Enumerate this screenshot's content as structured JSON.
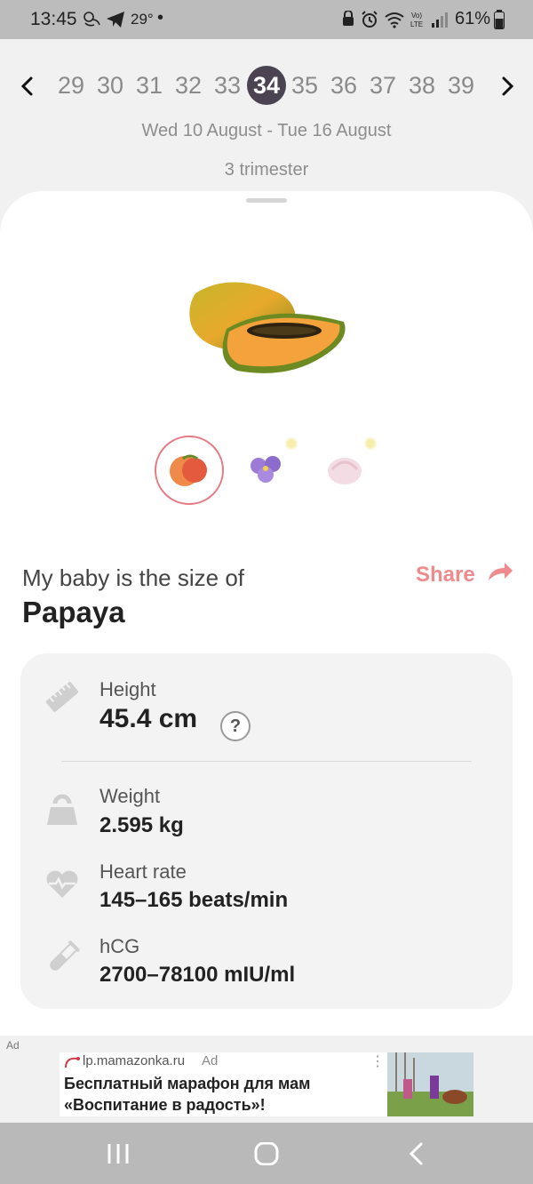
{
  "status_bar": {
    "time": "13:45",
    "temperature": "29°",
    "notification_dot": "•",
    "battery": "61%",
    "icons": [
      "baby-icon",
      "telegram-icon",
      "lock-icon",
      "alarm-icon",
      "wifi-icon",
      "volte-icon",
      "signal-icon",
      "battery-icon"
    ]
  },
  "week_selector": {
    "prev_icon": "chevron-left-icon",
    "next_icon": "chevron-right-icon",
    "weeks": [
      "29",
      "30",
      "31",
      "32",
      "33",
      "34",
      "35",
      "36",
      "37",
      "38",
      "39"
    ],
    "selected_week": "34"
  },
  "date_range": "Wed 10 August - Tue 16 August",
  "trimester": "3 trimester",
  "size_comparison": {
    "hero_icon": "papaya-image",
    "thumbnails": [
      "fruit-thumbnail",
      "flower-thumbnail",
      "marshmallow-thumbnail"
    ],
    "label": "My baby is the size of",
    "fruit": "Papaya",
    "share_label": "Share"
  },
  "stats": {
    "height_label": "Height",
    "height_value": "45.4 cm",
    "help_label": "?",
    "weight_label": "Weight",
    "weight_value": "2.595 kg",
    "heart_rate_label": "Heart rate",
    "heart_rate_value": "145–165 beats/min",
    "hcg_label": "hCG",
    "hcg_value": "2700–78100 mIU/ml"
  },
  "ad": {
    "tag": "Ad",
    "domain": "lp.mamazonka.ru",
    "label": "Ad",
    "title_line1": "Бесплатный марафон для мам",
    "title_line2": "«Воспитание в радость»!",
    "more": "⋮"
  },
  "colors": {
    "accent": "#4b4352",
    "share": "#f08a8d",
    "thumbnail_border": "#e57b85",
    "stats_bg": "#f3f3f3"
  }
}
